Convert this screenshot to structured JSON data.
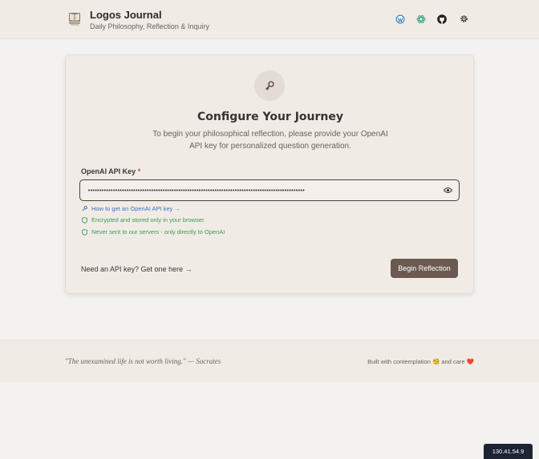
{
  "header": {
    "title": "Logos Journal",
    "subtitle": "Daily Philosophy, Reflection & Inquiry",
    "icons": [
      "book-icon",
      "wordpress-icon",
      "openai-icon",
      "github-icon",
      "gear-icon"
    ]
  },
  "setup": {
    "title": "Configure Your Journey",
    "description": "To begin your philosophical reflection, please provide your OpenAI API key for personalized question generation.",
    "field_label": "OpenAI API Key",
    "required_marker": "*",
    "api_key_value": "••••••••••••••••••••••••••••••••••••••••••••••••••••••••••••••••••••••••••••••••••••••••••••••••",
    "hints": {
      "how_to": "How to get an OpenAI API key →",
      "encrypted": "Encrypted and stored only in your browser",
      "never_sent": "Never sent to our servers - only directly to OpenAI"
    },
    "need_key_link": "Need an API key? Get one here →",
    "submit_label": "Begin Reflection"
  },
  "footer": {
    "quote": "\"The unexamined life is not worth living.\" — Socrates",
    "credit": "Built with contemplation 🧐 and care ❤️"
  },
  "ip_badge": "130.41.54.9",
  "colors": {
    "accent": "#6b5a50",
    "link": "#3e72c8",
    "success": "#3c9a55",
    "background": "#f4f2f0"
  }
}
